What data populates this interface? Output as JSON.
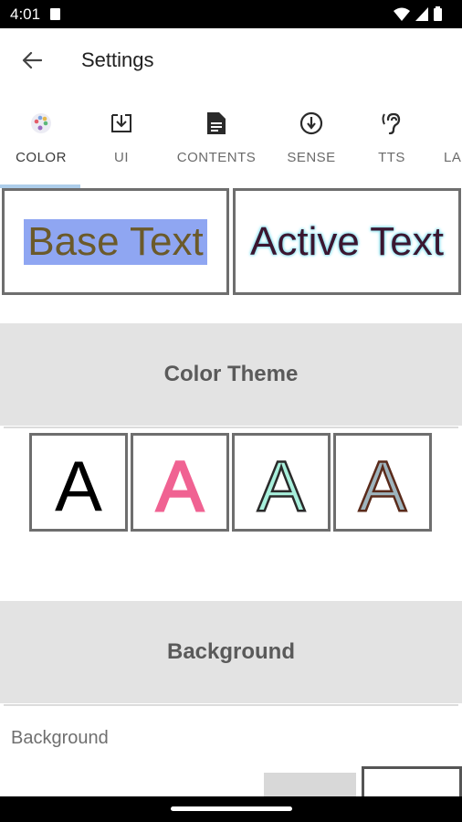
{
  "status": {
    "time": "4:01"
  },
  "app_bar": {
    "title": "Settings"
  },
  "tabs": [
    {
      "label": "COLOR",
      "icon": "palette-icon",
      "active": true
    },
    {
      "label": "UI",
      "icon": "download-box-icon"
    },
    {
      "label": "CONTENTS",
      "icon": "document-icon"
    },
    {
      "label": "SENSE",
      "icon": "download-circle-icon"
    },
    {
      "label": "TTS",
      "icon": "hearing-icon"
    },
    {
      "label": "LA",
      "icon": ""
    }
  ],
  "preview": {
    "base_text": "Base Text",
    "active_text": "Active Text"
  },
  "sections": {
    "color_theme": {
      "title": "Color Theme"
    },
    "background": {
      "title": "Background",
      "label": "Background"
    }
  },
  "themes": [
    {
      "glyph": "A",
      "fill": "#000000",
      "outline": "none"
    },
    {
      "glyph": "A",
      "fill": "#f06292",
      "outline": "#f06292"
    },
    {
      "glyph": "A",
      "fill": "#a8f0dc",
      "outline": "#2a2a2a"
    },
    {
      "glyph": "A",
      "fill": "#9eb4bd",
      "outline": "#5a2a1a"
    }
  ],
  "colors": {
    "base_text_fg": "#6b5a2a",
    "base_text_bg": "#8fa6f2",
    "active_text_fg": "#3b1630",
    "active_text_glow": "#8fe3f0",
    "accent": "#5b9bd5"
  }
}
